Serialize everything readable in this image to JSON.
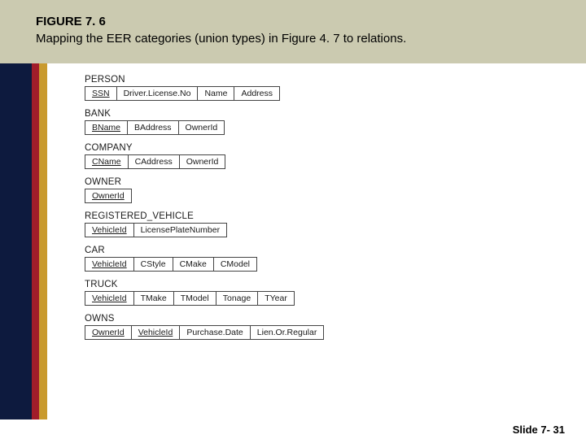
{
  "header": {
    "fig_num": "FIGURE 7. 6",
    "caption": "Mapping the EER categories (union types) in Figure 4. 7 to relations."
  },
  "relations": [
    {
      "name": "PERSON",
      "attrs": [
        "SSN",
        "Driver.License.No",
        "Name",
        "Address"
      ]
    },
    {
      "name": "BANK",
      "attrs": [
        "BName",
        "BAddress",
        "OwnerId"
      ]
    },
    {
      "name": "COMPANY",
      "attrs": [
        "CName",
        "CAddress",
        "OwnerId"
      ]
    },
    {
      "name": "OWNER",
      "attrs": [
        "OwnerId"
      ]
    },
    {
      "name": "REGISTERED_VEHICLE",
      "attrs": [
        "VehicleId",
        "LicensePlateNumber"
      ]
    },
    {
      "name": "CAR",
      "attrs": [
        "VehicleId",
        "CStyle",
        "CMake",
        "CModel"
      ]
    },
    {
      "name": "TRUCK",
      "attrs": [
        "VehicleId",
        "TMake",
        "TModel",
        "Tonage",
        "TYear"
      ]
    },
    {
      "name": "OWNS",
      "attrs": [
        "OwnerId",
        "VehicleId",
        "Purchase.Date",
        "Lien.Or.Regular"
      ]
    }
  ],
  "chart_data": {
    "type": "table",
    "title": "Relational schemas mapped from EER categories (union types)",
    "tables": [
      {
        "name": "PERSON",
        "columns": [
          "SSN",
          "Driver.License.No",
          "Name",
          "Address"
        ],
        "primary_key": [
          "SSN"
        ]
      },
      {
        "name": "BANK",
        "columns": [
          "BName",
          "BAddress",
          "OwnerId"
        ],
        "primary_key": [
          "BName"
        ]
      },
      {
        "name": "COMPANY",
        "columns": [
          "CName",
          "CAddress",
          "OwnerId"
        ],
        "primary_key": [
          "CName"
        ]
      },
      {
        "name": "OWNER",
        "columns": [
          "OwnerId"
        ],
        "primary_key": [
          "OwnerId"
        ]
      },
      {
        "name": "REGISTERED_VEHICLE",
        "columns": [
          "VehicleId",
          "LicensePlateNumber"
        ],
        "primary_key": [
          "VehicleId"
        ]
      },
      {
        "name": "CAR",
        "columns": [
          "VehicleId",
          "CStyle",
          "CMake",
          "CModel"
        ],
        "primary_key": [
          "VehicleId"
        ]
      },
      {
        "name": "TRUCK",
        "columns": [
          "VehicleId",
          "TMake",
          "TModel",
          "Tonage",
          "TYear"
        ],
        "primary_key": [
          "VehicleId"
        ]
      },
      {
        "name": "OWNS",
        "columns": [
          "OwnerId",
          "VehicleId",
          "Purchase.Date",
          "Lien.Or.Regular"
        ],
        "primary_key": [
          "OwnerId",
          "VehicleId"
        ]
      }
    ]
  },
  "footer": {
    "slide_label": "Slide 7- 31"
  }
}
